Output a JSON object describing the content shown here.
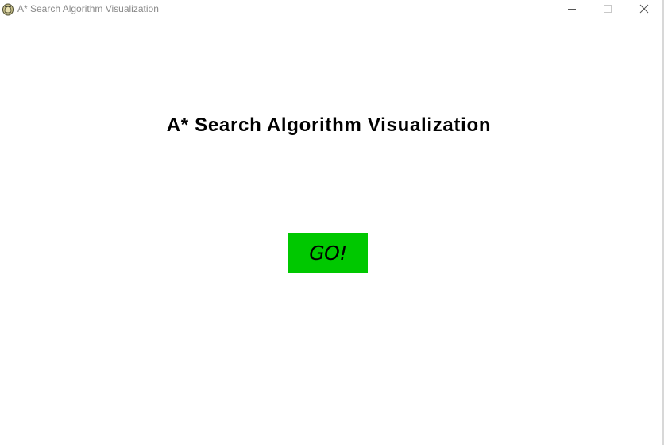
{
  "window": {
    "title": "A* Search Algorithm Visualization",
    "app_icon": "pygame-snake-icon",
    "controls": {
      "minimize_icon": "minimize-icon",
      "maximize_icon": "maximize-icon",
      "close_icon": "close-icon"
    }
  },
  "main": {
    "heading": "A* Search Algorithm Visualization",
    "go_button_label": "GO!"
  },
  "colors": {
    "background": "#ffffff",
    "go_button": "#00c800",
    "title_text": "#8a8a8a",
    "heading_text": "#000000"
  }
}
